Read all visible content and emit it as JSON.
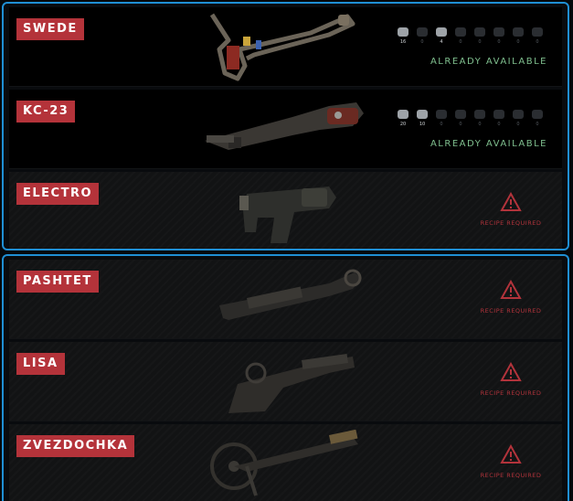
{
  "weapons": [
    {
      "name": "SWEDE",
      "status": "ALREADY AVAILABLE",
      "materials": [
        "16",
        "0",
        "4",
        "0",
        "0",
        "0",
        "0",
        "0"
      ]
    },
    {
      "name": "KC-23",
      "status": "ALREADY AVAILABLE",
      "materials": [
        "20",
        "10",
        "0",
        "0",
        "0",
        "0",
        "0",
        "0"
      ]
    },
    {
      "name": "ELECTRO",
      "status": "RECIPE REQUIRED"
    },
    {
      "name": "PASHTET",
      "status": "RECIPE REQUIRED"
    },
    {
      "name": "LISA",
      "status": "RECIPE REQUIRED"
    },
    {
      "name": "ZVEZDOCHKA",
      "status": "RECIPE REQUIRED"
    }
  ],
  "colors": {
    "accent_border": "#1f8fd4",
    "badge": "#b4333a",
    "available": "#7fbf8e",
    "warning": "#b2333b"
  },
  "icons": {
    "material": "crafting-material-icon",
    "warning": "warning-triangle-icon"
  }
}
